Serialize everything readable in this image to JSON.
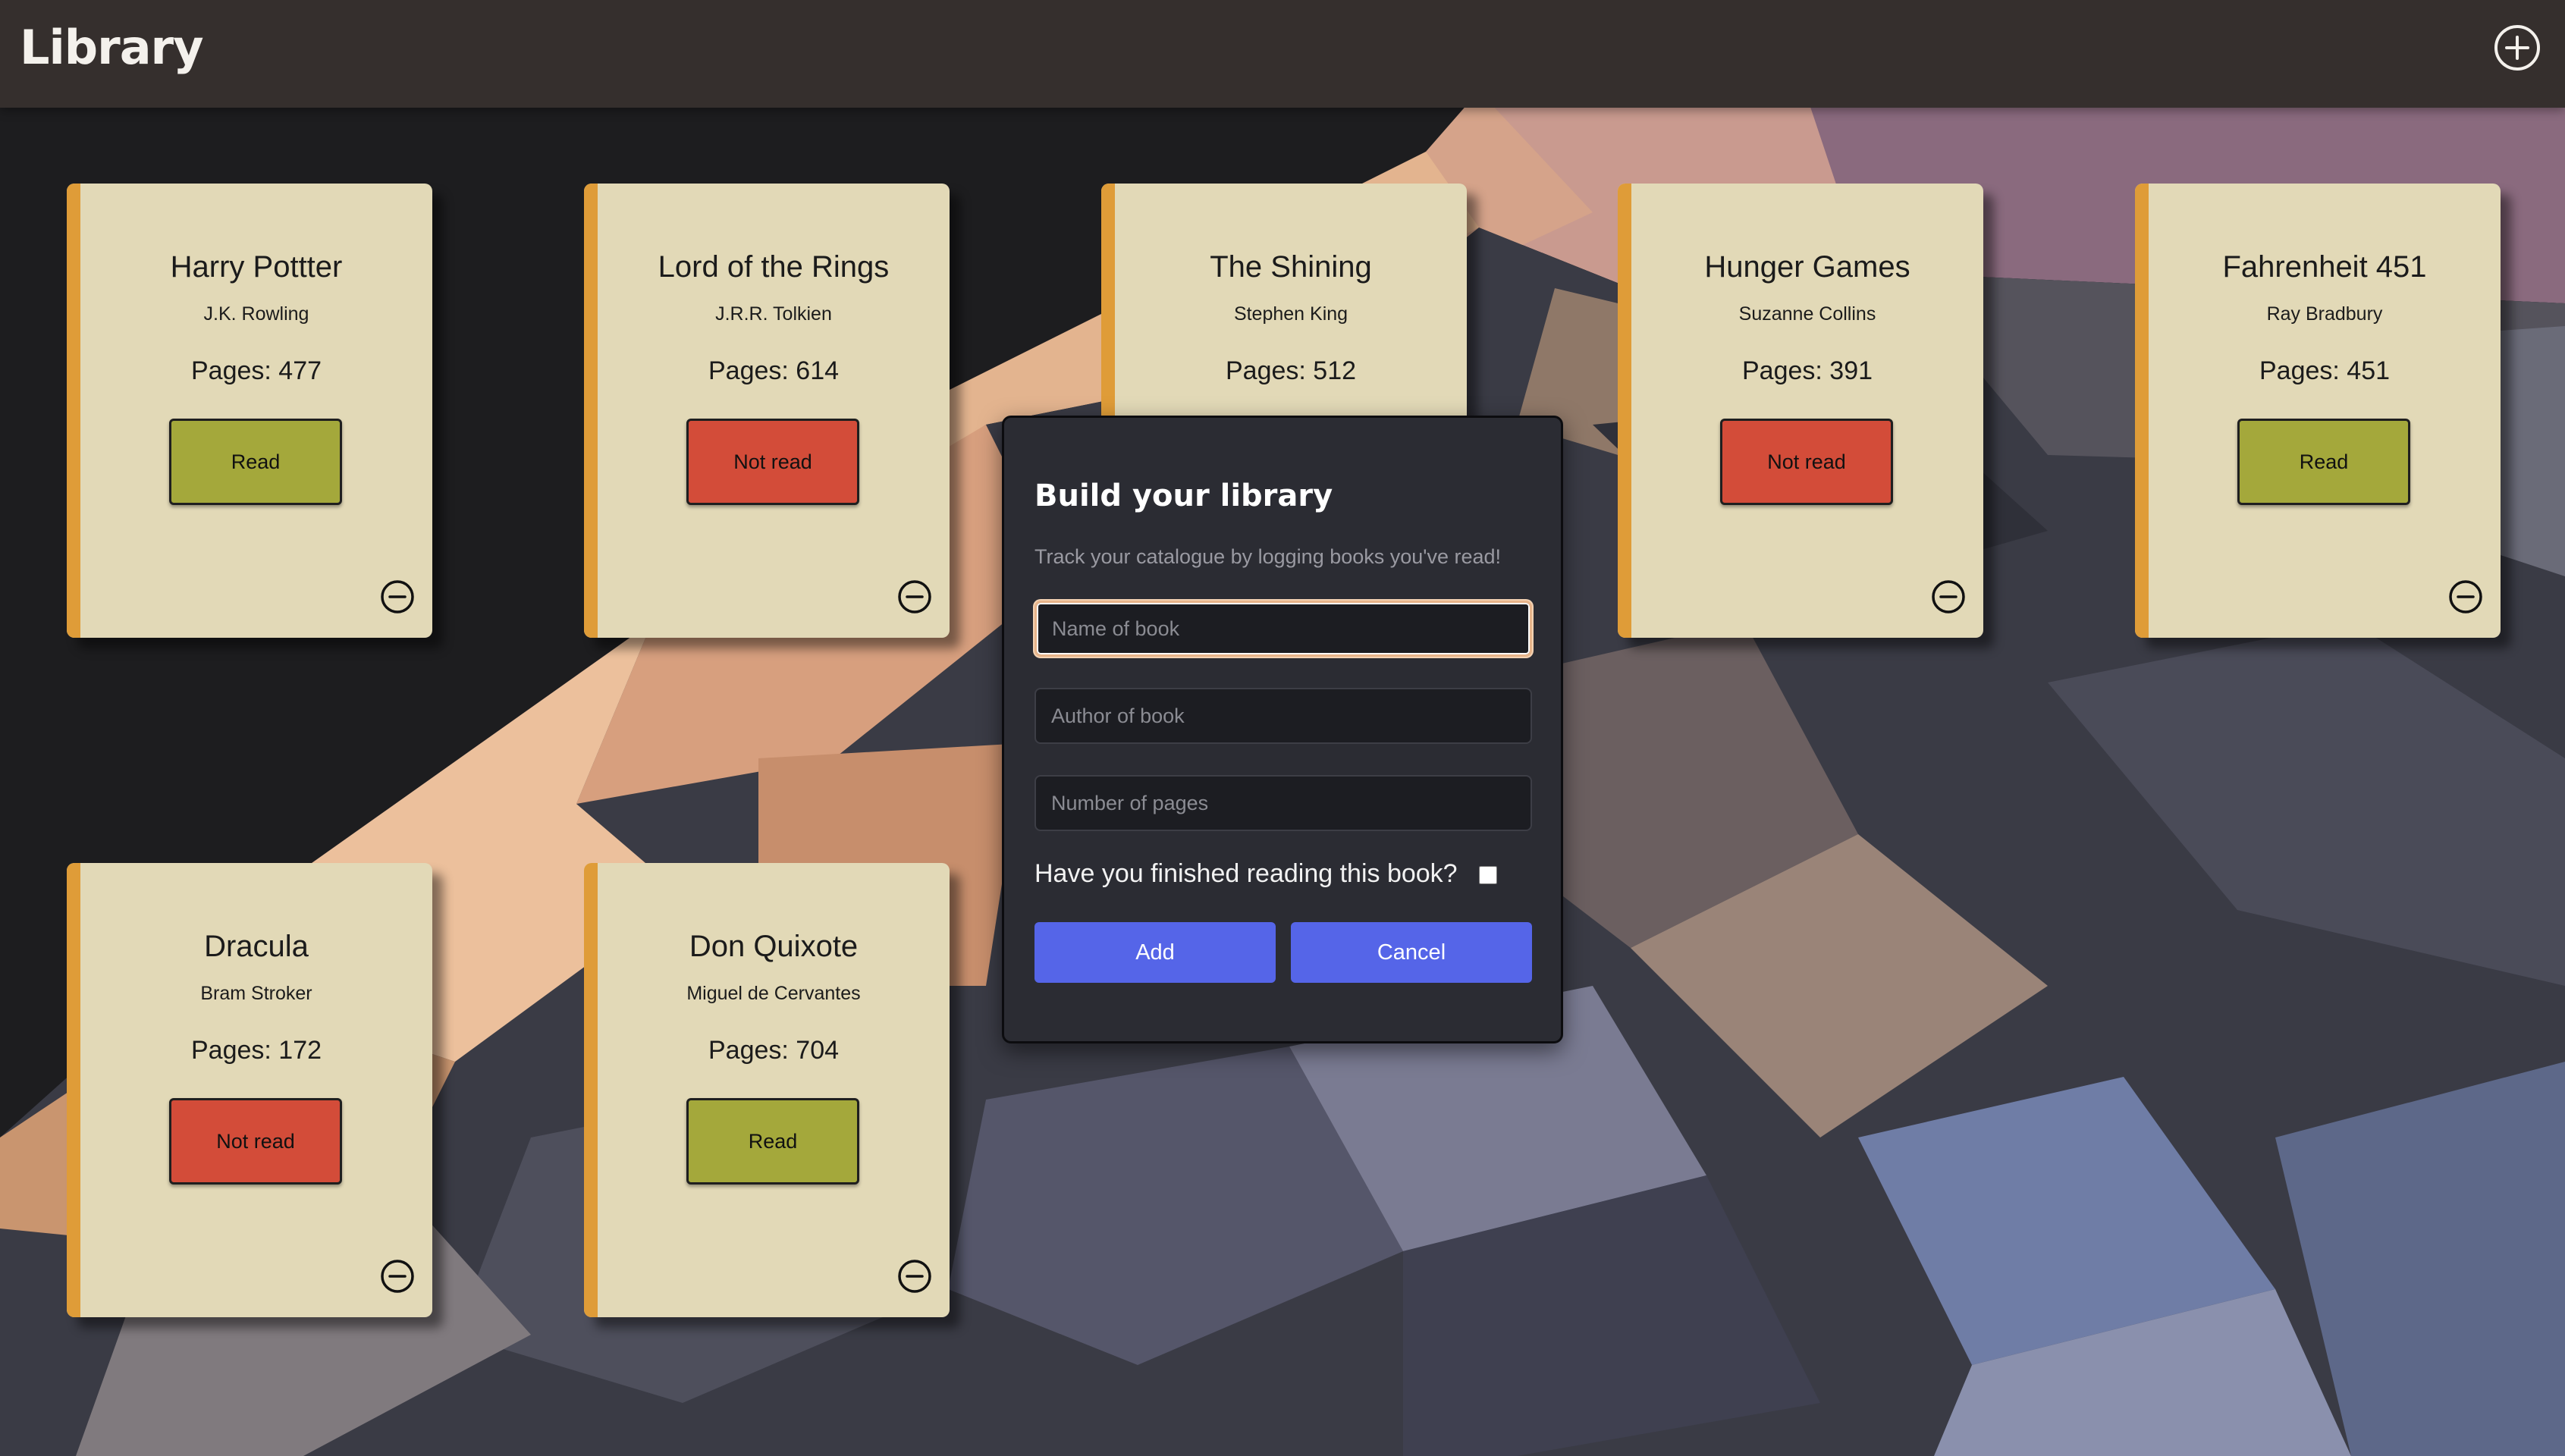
{
  "header": {
    "title": "Library",
    "add_icon": "plus-circle-icon"
  },
  "books": [
    {
      "title": "Harry Pottter",
      "author": "J.K. Rowling",
      "pages": "Pages: 477",
      "status": "Read"
    },
    {
      "title": "Lord of the Rings",
      "author": "J.R.R. Tolkien",
      "pages": "Pages: 614",
      "status": "Not read"
    },
    {
      "title": "The Shining",
      "author": "Stephen King",
      "pages": "Pages: 512",
      "status": ""
    },
    {
      "title": "Hunger Games",
      "author": "Suzanne Collins",
      "pages": "Pages: 391",
      "status": "Not read"
    },
    {
      "title": "Fahrenheit 451",
      "author": "Ray Bradbury",
      "pages": "Pages: 451",
      "status": "Read"
    },
    {
      "title": "Dracula",
      "author": "Bram Stroker",
      "pages": "Pages: 172",
      "status": "Not read"
    },
    {
      "title": "Don Quixote",
      "author": "Miguel de Cervantes",
      "pages": "Pages: 704",
      "status": "Read"
    }
  ],
  "modal": {
    "title": "Build your library",
    "subtitle": "Track your catalogue by logging books you've read!",
    "name_placeholder": "Name of book",
    "author_placeholder": "Author of book",
    "pages_placeholder": "Number of pages",
    "finished_label": "Have you finished reading this book?",
    "finished_checked": false,
    "add_label": "Add",
    "cancel_label": "Cancel"
  },
  "colors": {
    "card_background": "#e2d9b7",
    "card_spine": "#df9c38",
    "read_button": "#a4a83b",
    "not_read_button": "#d34c39",
    "modal_button": "#5565e8",
    "header_background": "#352f2d"
  }
}
